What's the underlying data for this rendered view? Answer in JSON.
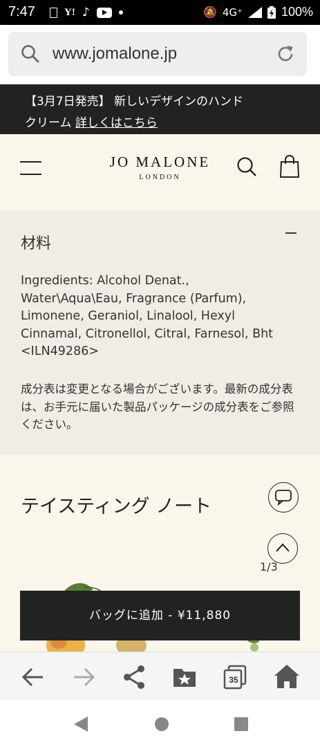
{
  "status_bar": {
    "time": "7:47",
    "network": "4G⁺",
    "battery": "100%"
  },
  "browser": {
    "url": "www.jomalone.jp",
    "tab_count": "35"
  },
  "announcement": {
    "line1": "【3月7日発売】 新しいデザインのハンド",
    "line2_prefix": "クリーム ",
    "link": "詳しくはこちら"
  },
  "header": {
    "logo": "JO MALONE",
    "logo_sub": "LONDON"
  },
  "ingredients": {
    "heading": "材料",
    "text": "Ingredients: Alcohol Denat.,\nWater\\Aqua\\Eau, Fragrance (Parfum),\nLimonene, Geraniol, Linalool, Hexyl\nCinnamal, Citronellol, Citral, Farnesol, Bht\n<ILN49286>",
    "note": "成分表は変更となる場合がございます。最新の成分表は、お手元に届いた製品パッケージの成分表をご参照ください。"
  },
  "tasting": {
    "title": "テイスティング ノート",
    "pager": "1/3"
  },
  "add_to_bag": {
    "label": "バッグに追加 - ¥11,880"
  }
}
